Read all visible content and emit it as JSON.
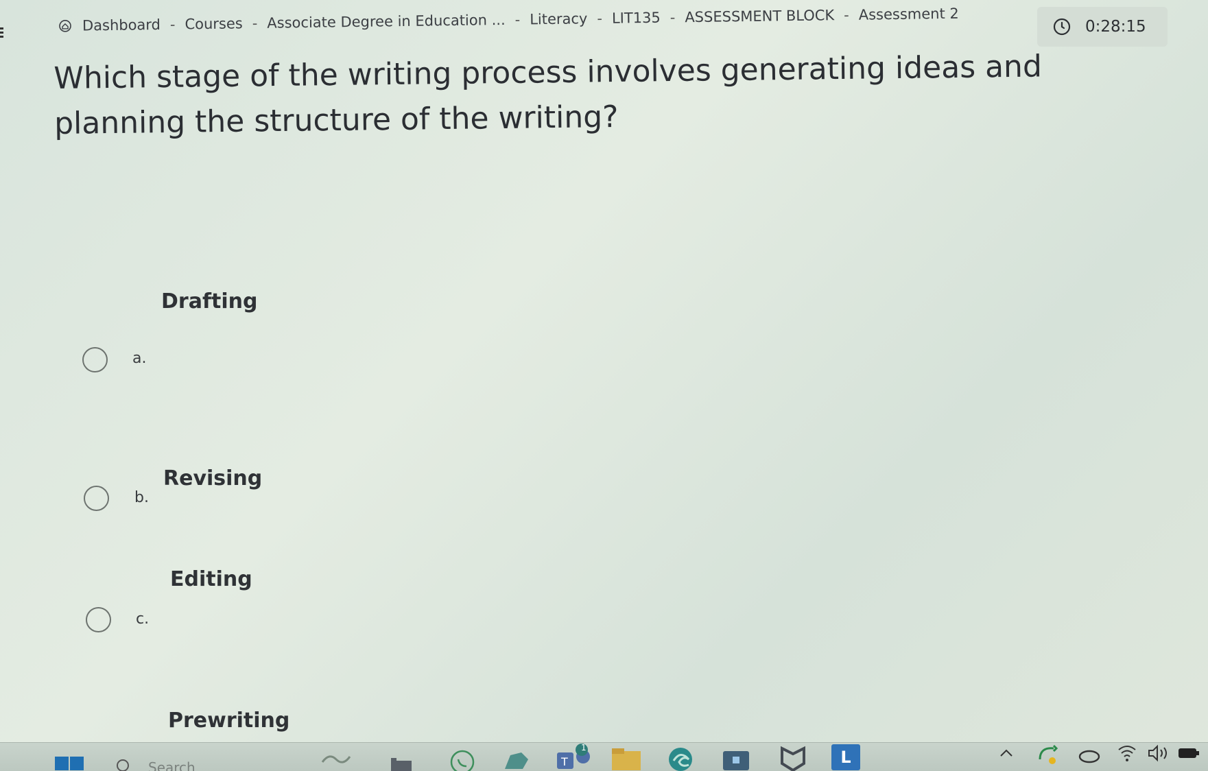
{
  "breadcrumb": {
    "items": [
      "Dashboard",
      "Courses",
      "Associate Degree in Education ...",
      "Literacy",
      "LIT135",
      "ASSESSMENT BLOCK",
      "Assessment 2"
    ],
    "separator": "-"
  },
  "timer": {
    "value": "0:28:15"
  },
  "question": {
    "text": "Which stage of the writing process involves generating ideas and planning the structure of the writing?"
  },
  "options": [
    {
      "letter": "a.",
      "text": "Drafting"
    },
    {
      "letter": "b.",
      "text": "Revising"
    },
    {
      "letter": "c.",
      "text": "Editing"
    },
    {
      "letter": "",
      "text": "Prewriting"
    }
  ],
  "taskbar": {
    "search_placeholder": "Search",
    "teams_badge": "1",
    "app_letter": "L",
    "icons": [
      "start-icon",
      "search-icon",
      "widgets-icon",
      "file-icon",
      "whatsapp-icon",
      "pinned-app-icon",
      "teams-icon",
      "folder-icon",
      "edge-icon",
      "store-icon",
      "shield-icon",
      "l-app-icon",
      "chevron-up-icon",
      "sync-icon",
      "cloud-icon",
      "wifi-icon",
      "volume-icon",
      "battery-icon"
    ]
  },
  "colors": {
    "background": "#dfe9e1",
    "text": "#2b2e33",
    "radio_border": "#6d736f",
    "taskbar": "#c3cec6",
    "accent_blue": "#1f6fb2"
  }
}
